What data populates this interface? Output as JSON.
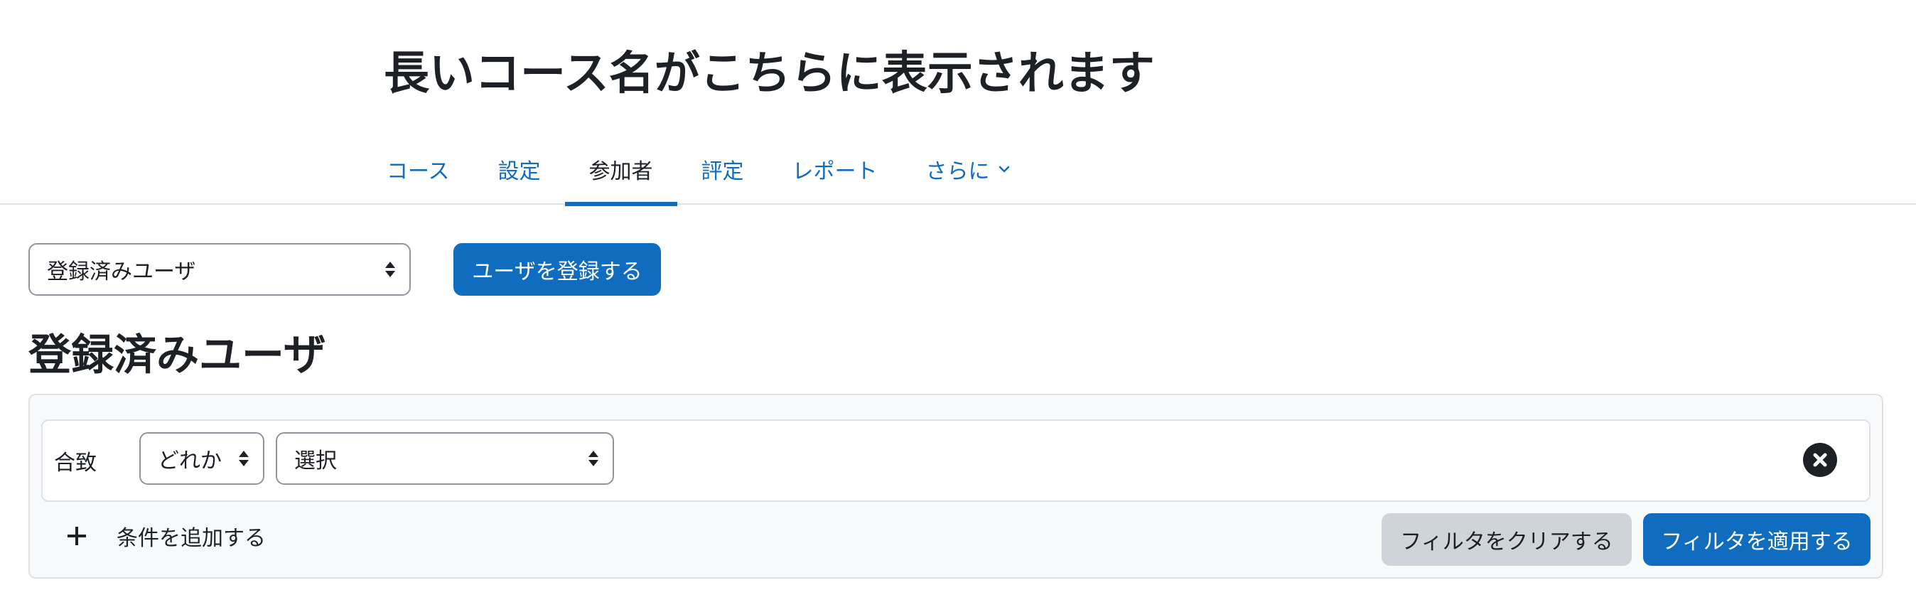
{
  "course": {
    "title": "長いコース名がこちらに表示されます"
  },
  "nav": {
    "items": [
      {
        "label": "コース"
      },
      {
        "label": "設定"
      },
      {
        "label": "参加者"
      },
      {
        "label": "評定"
      },
      {
        "label": "レポート"
      },
      {
        "label": "さらに"
      }
    ],
    "active": "参加者"
  },
  "toolbar": {
    "view_select_value": "登録済みユーザ",
    "enrol_button_label": "ユーザを登録する"
  },
  "page": {
    "heading": "登録済みユーザ"
  },
  "filters": {
    "match_label": "合致",
    "match_select_value": "どれか",
    "type_select_value": "選択",
    "add_condition_label": "条件を追加する",
    "clear_button_label": "フィルタをクリアする",
    "apply_button_label": "フィルタを適用する"
  },
  "colors": {
    "accent": "#0f6cbf",
    "text": "#1d2125",
    "secondary_button": "#ced4da",
    "panel_bg": "#f8f9fa",
    "border": "#dee2e6"
  },
  "icons": {
    "more_chevron": "chevron-down-icon",
    "select_caret": "sort-caret-icon",
    "remove_filter": "close-circle-icon",
    "add_condition": "plus-icon"
  }
}
